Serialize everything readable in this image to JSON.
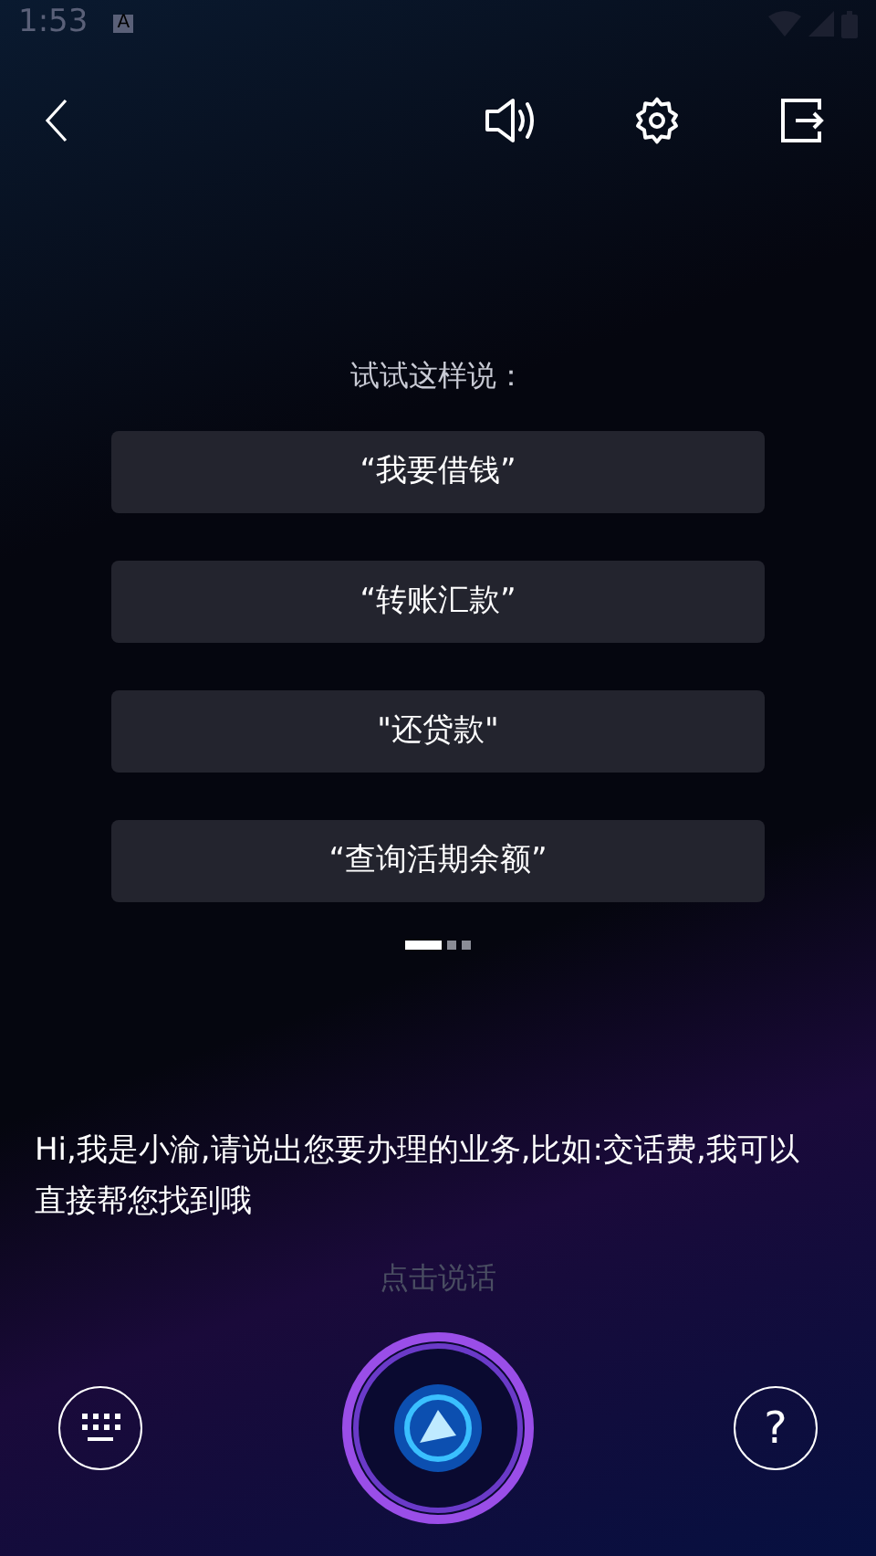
{
  "status_bar": {
    "time": "1:53",
    "notification": "A"
  },
  "prompt_title": "试试这样说：",
  "suggestions": [
    {
      "label": "“我要借钱”"
    },
    {
      "label": "“转账汇款”"
    },
    {
      "label": "\"还贷款\""
    },
    {
      "label": "“查询活期余额”"
    }
  ],
  "pager": [
    {
      "selected": true
    },
    {
      "selected": false
    },
    {
      "selected": false
    }
  ],
  "greeting": "Hi,我是小渝,请说出您要办理的业务,比如:交话费,我可以直接帮您找到哦",
  "speak_hint": "点击说话",
  "help_button": "?"
}
